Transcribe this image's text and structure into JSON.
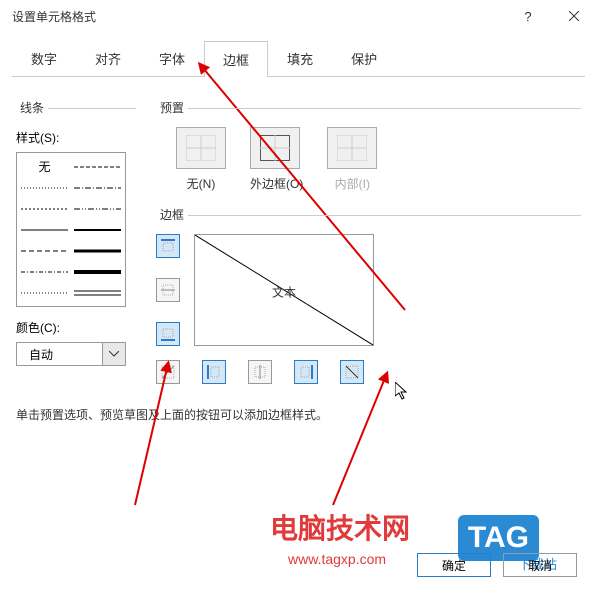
{
  "title": "设置单元格格式",
  "tabs": [
    "数字",
    "对齐",
    "字体",
    "边框",
    "填充",
    "保护"
  ],
  "activeTab": 3,
  "line": {
    "label": "线条",
    "styleLabel": "样式(S):",
    "none": "无",
    "colorLabel": "颜色(C):",
    "colorValue": "自动"
  },
  "preset": {
    "label": "预置",
    "items": [
      {
        "label": "无(N)"
      },
      {
        "label": "外边框(O)"
      },
      {
        "label": "内部(I)",
        "disabled": true
      }
    ]
  },
  "border": {
    "label": "边框",
    "previewText": "文本"
  },
  "hint": "单击预置选项、预览草图及上面的按钮可以添加边框样式。",
  "buttons": {
    "ok": "确定",
    "cancel": "取消"
  },
  "watermark": {
    "title": "电脑技术网",
    "url": "www.tagxp.com",
    "tag": "TAG",
    "site": "下载站"
  }
}
